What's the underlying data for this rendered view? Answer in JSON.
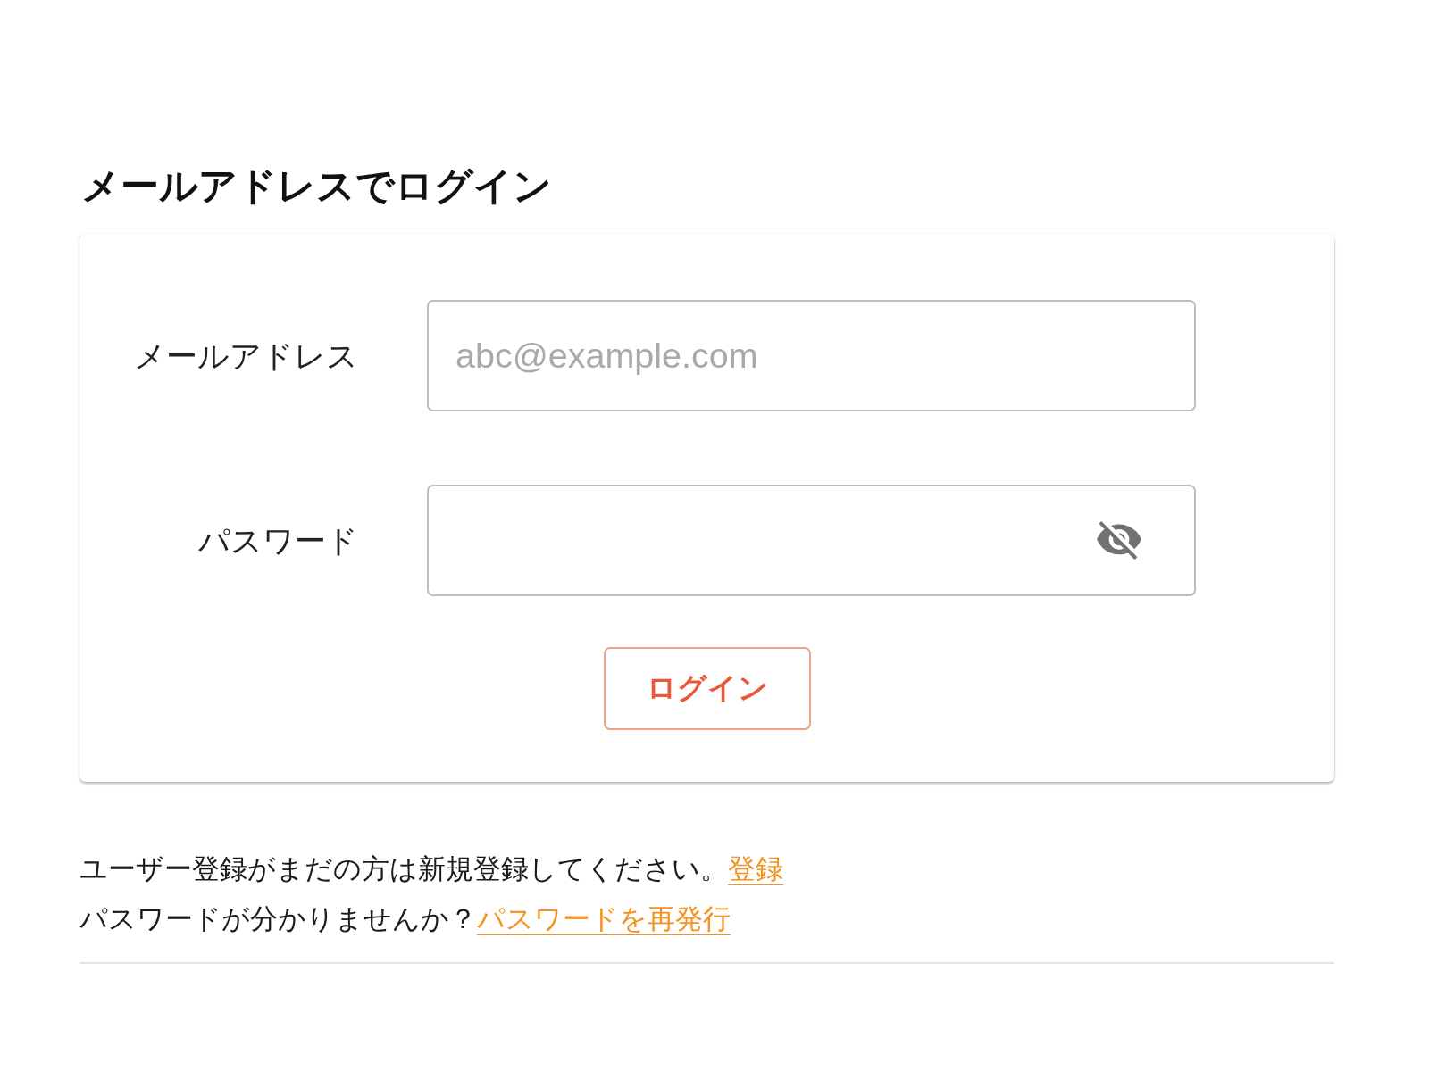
{
  "title": "メールアドレスでログイン",
  "form": {
    "fields": [
      {
        "kind": "email",
        "label": "メールアドレス",
        "placeholder": "abc@example.com"
      },
      {
        "kind": "password",
        "label": "パスワード",
        "password_visible": false
      }
    ],
    "submit_button": "ログイン"
  },
  "help_lines": [
    {
      "text": "ユーザー登録がまだの方は新規登録してください。",
      "link": "登録"
    },
    {
      "text": "パスワードが分かりませんか？",
      "link": "パスワードを再発行"
    }
  ]
}
